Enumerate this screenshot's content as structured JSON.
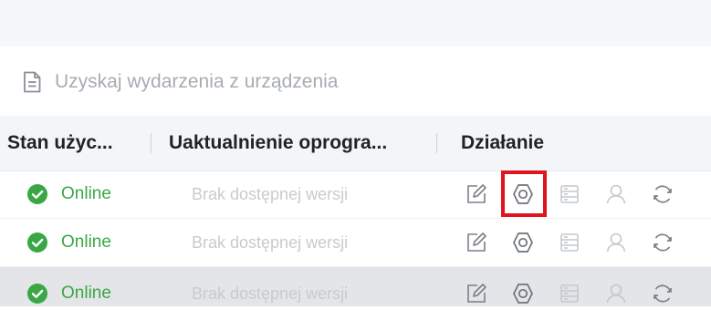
{
  "toolbar": {
    "get_events_label": "Uzyskaj wydarzenia z urządzenia",
    "get_events_icon": "document-icon"
  },
  "table": {
    "columns": [
      "Stan użyc...",
      "Uaktualnienie oprogra...",
      "Działanie"
    ],
    "rows": [
      {
        "status": "Online",
        "upgrade": "Brak dostępnej wersji",
        "selected": false
      },
      {
        "status": "Online",
        "upgrade": "Brak dostępnej wersji",
        "selected": false
      },
      {
        "status": "Online",
        "upgrade": "Brak dostępnej wersji",
        "selected": true
      }
    ],
    "action_icons": [
      "edit-icon",
      "settings-icon",
      "storage-icon",
      "user-icon",
      "refresh-icon"
    ]
  },
  "colors": {
    "online_green": "#3aa745",
    "highlight_red": "#e0141e",
    "icon_gray": "#7b8088",
    "icon_disabled": "#c4c8cd"
  }
}
